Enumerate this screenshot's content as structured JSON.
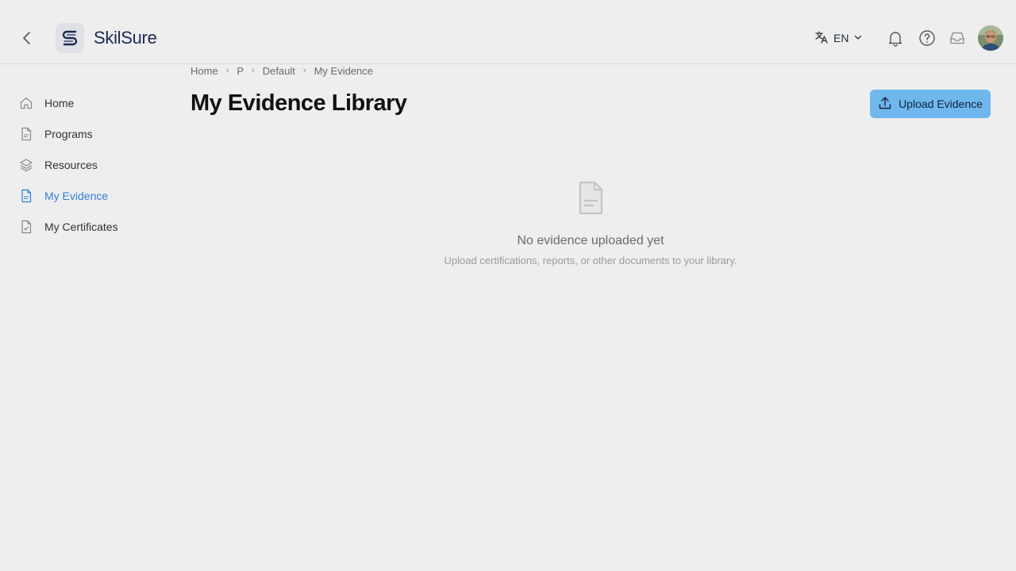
{
  "header": {
    "brand": "SkilSure",
    "language": "EN"
  },
  "sidebar": {
    "items": [
      {
        "label": "Home",
        "icon": "home-icon"
      },
      {
        "label": "Programs",
        "icon": "document-icon"
      },
      {
        "label": "Resources",
        "icon": "layers-icon"
      },
      {
        "label": "My Evidence",
        "icon": "evidence-icon",
        "active": true
      },
      {
        "label": "My Certificates",
        "icon": "certificate-icon"
      }
    ]
  },
  "breadcrumb": [
    "Home",
    "P",
    "Default",
    "My Evidence"
  ],
  "main": {
    "title": "My Evidence Library",
    "upload_label": "Upload Evidence",
    "empty_title": "No evidence uploaded yet",
    "empty_subtitle": "Upload certifications, reports, or other documents to your library."
  },
  "colors": {
    "accent": "#2f7fd8",
    "button": "#6fb7ec",
    "background": "#eeeeee"
  }
}
